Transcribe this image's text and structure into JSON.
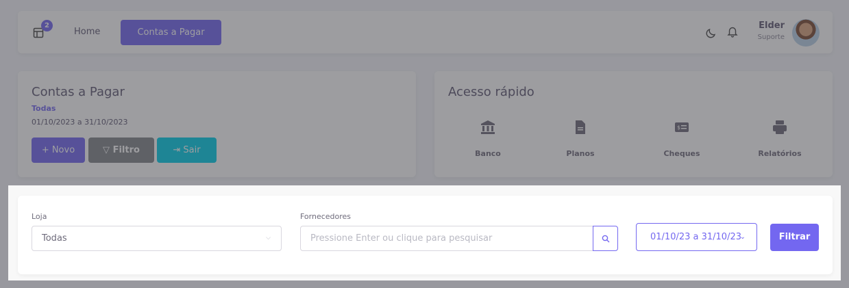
{
  "topbar": {
    "badge_count": "2",
    "nav_home": "Home",
    "nav_active": "Contas a Pagar",
    "user_name": "Elder",
    "user_role": "Suporte"
  },
  "summary": {
    "title": "Contas a Pagar",
    "store": "Todas",
    "date_range": "01/10/2023 a 31/10/2023",
    "btn_novo": "+ Novo",
    "btn_filtro": "Filtro",
    "btn_sair": "Sair"
  },
  "quick_access": {
    "title": "Acesso rápido",
    "items": [
      {
        "label": "Banco",
        "icon": "bank-icon"
      },
      {
        "label": "Planos",
        "icon": "file-icon"
      },
      {
        "label": "Cheques",
        "icon": "cheque-icon"
      },
      {
        "label": "Relatórios",
        "icon": "printer-icon"
      }
    ]
  },
  "filter": {
    "loja_label": "Loja",
    "loja_value": "Todas",
    "fornecedores_label": "Fornecedores",
    "fornecedores_placeholder": "Pressione Enter ou clique para pesquisar",
    "date_range": "01/10/23 a 31/10/23",
    "submit_label": "Filtrar"
  },
  "colors": {
    "primary": "#7367f0",
    "secondary": "#82868b",
    "info": "#00cfe8"
  }
}
